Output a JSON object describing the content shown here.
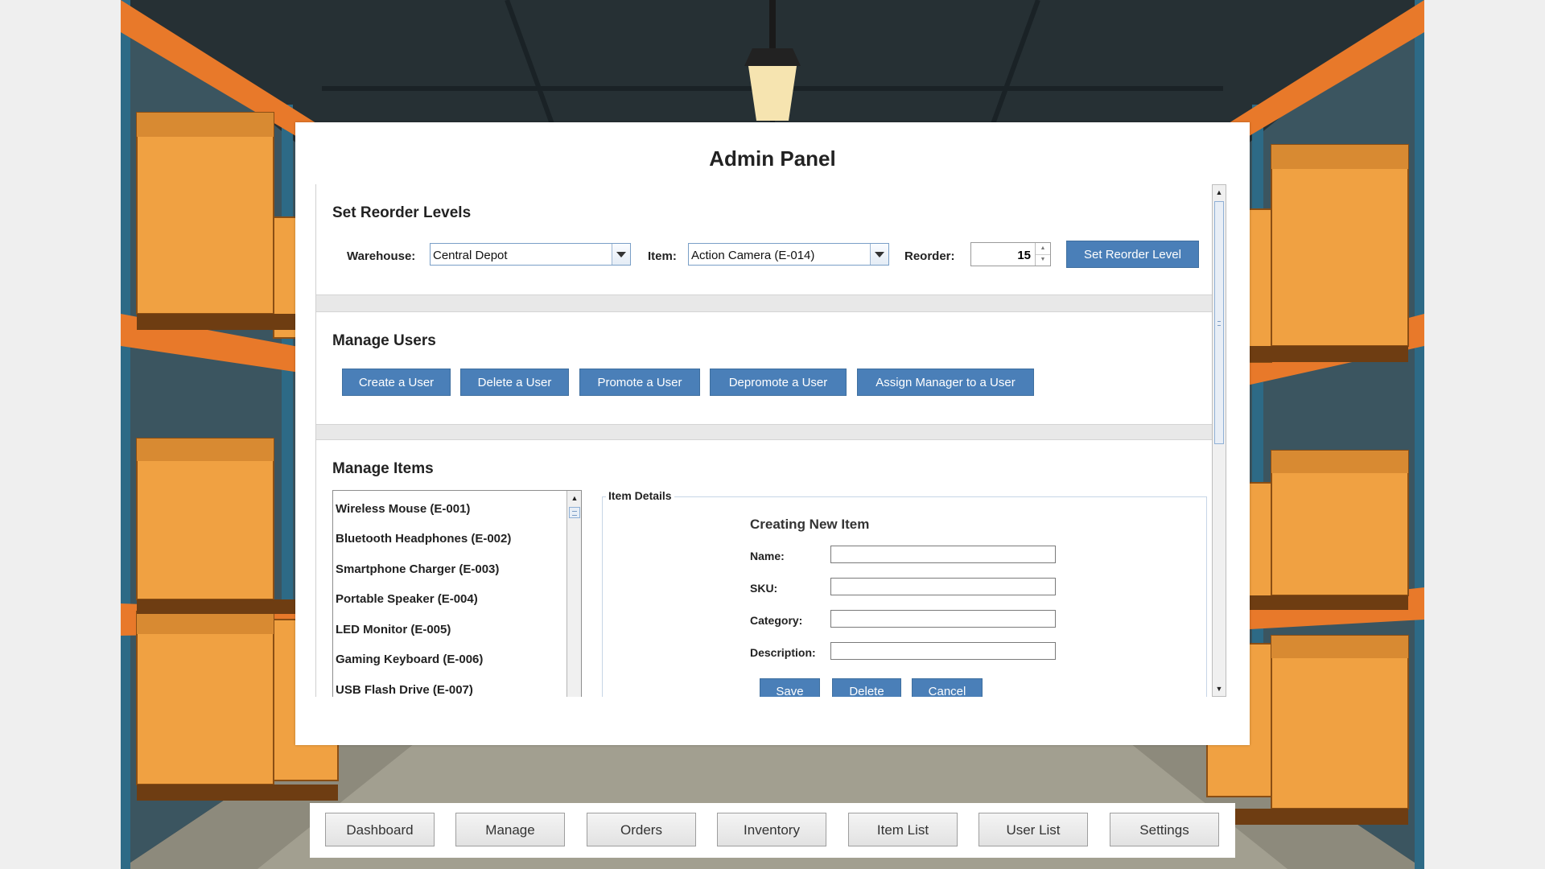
{
  "app": {
    "title": "Admin Panel"
  },
  "reorder": {
    "heading": "Set Reorder Levels",
    "warehouse_label": "Warehouse:",
    "warehouse_value": "Central Depot",
    "item_label": "Item:",
    "item_value": "Action Camera (E-014)",
    "reorder_label": "Reorder:",
    "reorder_value": "15",
    "button": "Set Reorder Level"
  },
  "users": {
    "heading": "Manage Users",
    "buttons": [
      "Create a User",
      "Delete a User",
      "Promote a User",
      "Depromote a User",
      "Assign Manager to a User"
    ]
  },
  "items": {
    "heading": "Manage Items",
    "list": [
      "Wireless Mouse (E-001)",
      "Bluetooth Headphones (E-002)",
      "Smartphone Charger (E-003)",
      "Portable Speaker (E-004)",
      "LED Monitor (E-005)",
      "Gaming Keyboard (E-006)",
      "USB Flash Drive (E-007)"
    ],
    "details": {
      "legend": "Item Details",
      "subtitle": "Creating New Item",
      "name_label": "Name:",
      "sku_label": "SKU:",
      "category_label": "Category:",
      "description_label": "Description:",
      "name_value": "",
      "sku_value": "",
      "category_value": "",
      "description_value": "",
      "save": "Save",
      "delete": "Delete",
      "cancel": "Cancel"
    }
  },
  "nav": {
    "buttons": [
      "Dashboard",
      "Manage",
      "Orders",
      "Inventory",
      "Item List",
      "User List",
      "Settings"
    ]
  },
  "colors": {
    "accent": "#4a7fb8",
    "shelf_orange": "#e8792a",
    "box_orange": "#f0a142",
    "steel_blue": "#2f6f8a"
  }
}
